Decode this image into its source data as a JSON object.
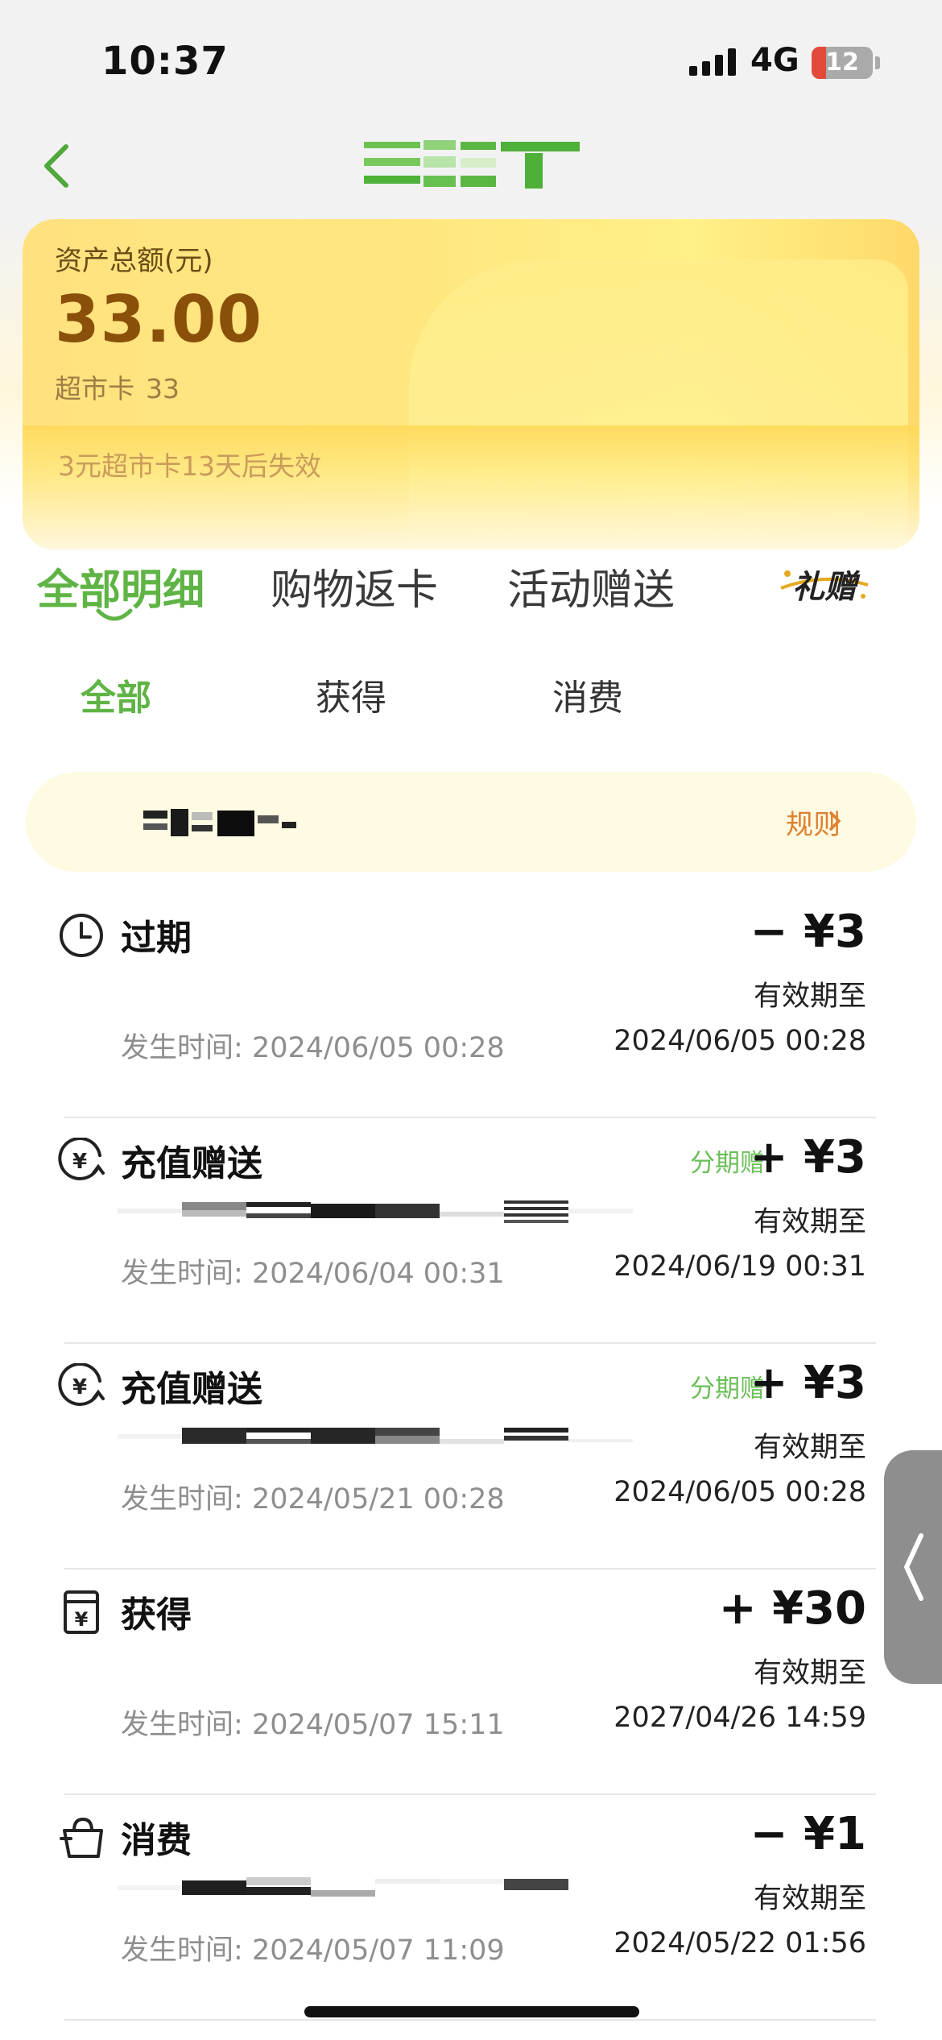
{
  "status_bar": {
    "time": "10:37",
    "network": "4G",
    "battery": "12"
  },
  "asset": {
    "label": "资产总额(元)",
    "amount": "33.00",
    "card_type": "超市卡",
    "card_value": "33",
    "expire_note": "3元超市卡13天后失效"
  },
  "main_tabs": [
    "全部明细",
    "购物返卡",
    "活动赠送"
  ],
  "gift_logo_text": "礼赠",
  "sub_tabs": [
    "全部",
    "获得",
    "消费"
  ],
  "banner": {
    "rules_label": "规则"
  },
  "records": [
    {
      "icon": "clock-icon",
      "title": "过期",
      "tag": "",
      "amount": "− ¥3",
      "validity_label": "有效期至",
      "time_label": "发生时间:",
      "time": "2024/06/05 00:28",
      "valid_until": "2024/06/05 00:28"
    },
    {
      "icon": "yuan-refresh-icon",
      "title": "充值赠送",
      "tag": "分期赠",
      "amount": "+ ¥3",
      "validity_label": "有效期至",
      "time_label": "发生时间:",
      "time": "2024/06/04 00:31",
      "valid_until": "2024/06/19 00:31"
    },
    {
      "icon": "yuan-refresh-icon",
      "title": "充值赠送",
      "tag": "分期赠",
      "amount": "+ ¥3",
      "validity_label": "有效期至",
      "time_label": "发生时间:",
      "time": "2024/05/21 00:28",
      "valid_until": "2024/06/05 00:28"
    },
    {
      "icon": "yuan-card-icon",
      "title": "获得",
      "tag": "",
      "amount": "+ ¥30",
      "validity_label": "有效期至",
      "time_label": "发生时间:",
      "time": "2024/05/07 15:11",
      "valid_until": "2027/04/26 14:59"
    },
    {
      "icon": "shopping-bag-icon",
      "title": "消费",
      "tag": "",
      "amount": "− ¥1",
      "validity_label": "有效期至",
      "time_label": "发生时间:",
      "time": "2024/05/07 11:09",
      "valid_until": "2024/05/22 01:56"
    }
  ],
  "colors": {
    "accent_green": "#5fb445",
    "tag_green": "#6bbf57",
    "amount_brown": "#8a4f08",
    "rules_orange": "#e07f2e",
    "card_yellow": "#ffe780"
  }
}
